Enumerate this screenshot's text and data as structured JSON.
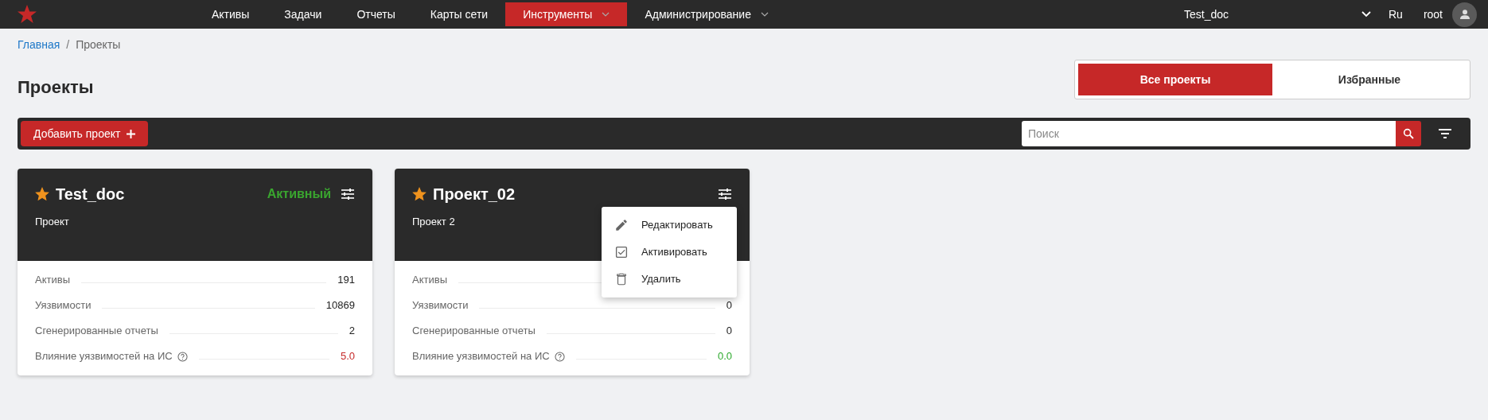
{
  "topbar": {
    "nav": [
      {
        "label": "Активы",
        "selected": false,
        "dropdown": false
      },
      {
        "label": "Задачи",
        "selected": false,
        "dropdown": false
      },
      {
        "label": "Отчеты",
        "selected": false,
        "dropdown": false
      },
      {
        "label": "Карты сети",
        "selected": false,
        "dropdown": false
      },
      {
        "label": "Инструменты",
        "selected": true,
        "dropdown": true
      },
      {
        "label": "Администрирование",
        "selected": false,
        "dropdown": true
      }
    ],
    "project": "Test_doc",
    "language": "Ru",
    "user": "root"
  },
  "breadcrumb": {
    "separator": "/",
    "items": [
      {
        "label": "Главная",
        "link": true
      },
      {
        "label": "Проекты",
        "link": false
      }
    ]
  },
  "page_title": "Проекты",
  "view_tabs": [
    {
      "label": "Все проекты",
      "selected": true
    },
    {
      "label": "Избранные",
      "selected": false
    }
  ],
  "toolbar": {
    "add_button": "Добавить проект",
    "search": {
      "placeholder": "Поиск"
    }
  },
  "cards": [
    {
      "title": "Test_doc",
      "favorite": true,
      "status": "Активный",
      "description": "Проект",
      "stats": [
        {
          "label": "Активы",
          "value": "191"
        },
        {
          "label": "Уязвимости",
          "value": "10869"
        },
        {
          "label": "Сгенерированные отчеты",
          "value": "2"
        },
        {
          "label": "Влияние уязвимостей на ИС",
          "value": "5.0",
          "help": true,
          "color": "#c62828"
        }
      ]
    },
    {
      "title": "Проект_02",
      "favorite": true,
      "description": "Проект 2",
      "menu_open": true,
      "menu": [
        {
          "label": "Редактировать",
          "kind": "edit"
        },
        {
          "label": "Активировать",
          "kind": "activate"
        },
        {
          "label": "Удалить",
          "kind": "delete"
        }
      ],
      "stats": [
        {
          "label": "Активы"
        },
        {
          "label": "Уязвимости",
          "value": "0"
        },
        {
          "label": "Сгенерированные отчеты",
          "value": "0"
        },
        {
          "label": "Влияние уязвимостей на ИС",
          "value": "0.0",
          "help": true,
          "color": "#2eaa2e"
        }
      ]
    }
  ]
}
